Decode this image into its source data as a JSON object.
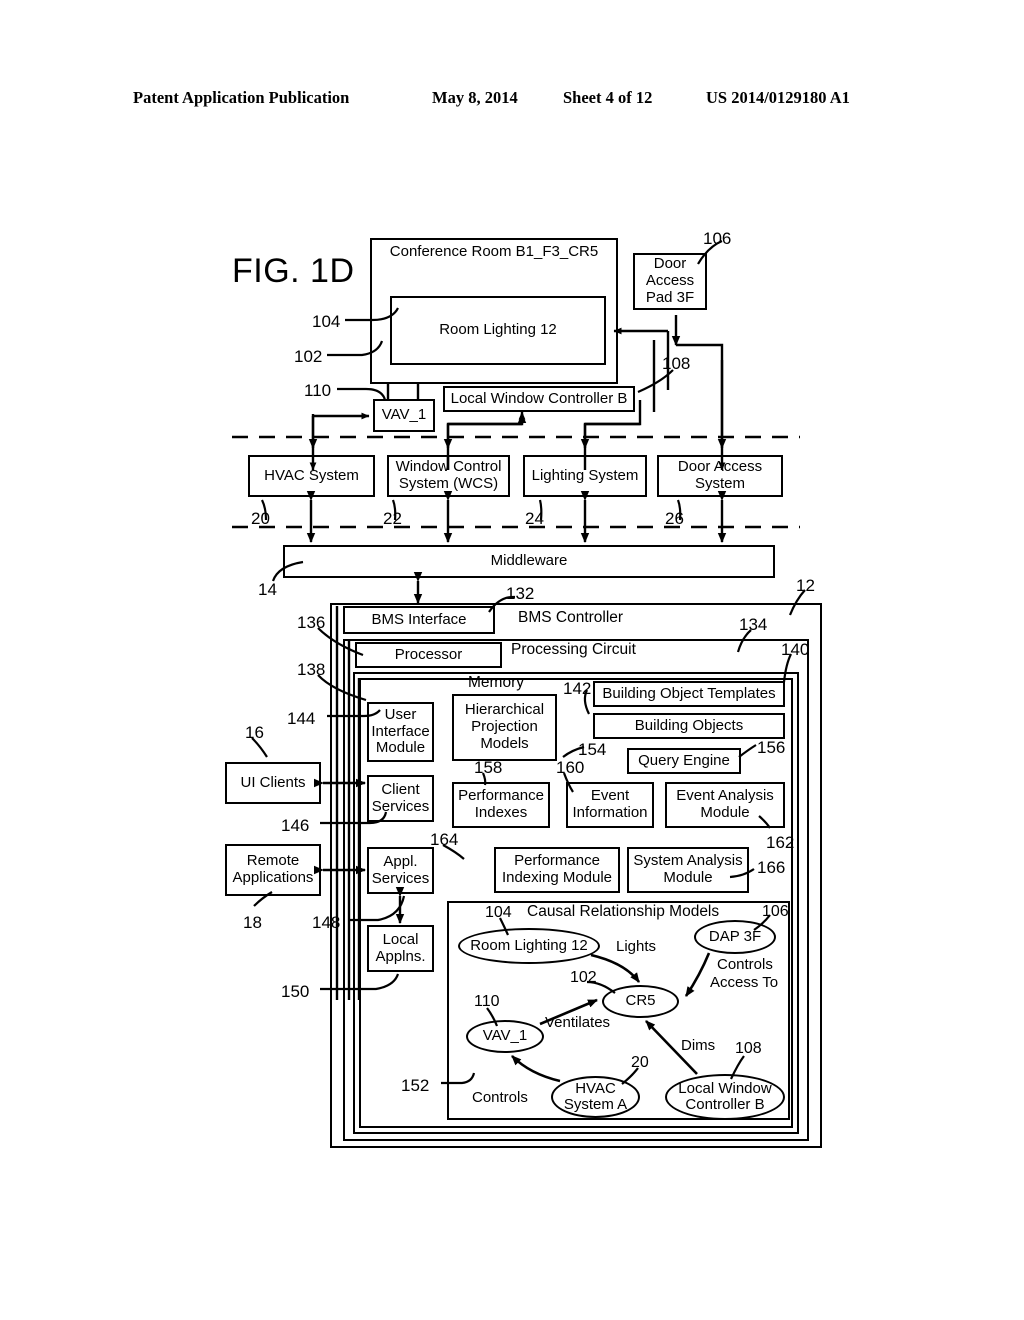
{
  "header": {
    "publication": "Patent Application Publication",
    "date": "May 8, 2014",
    "sheet": "Sheet 4 of 12",
    "patent_number": "US 2014/0129180 A1"
  },
  "figure": {
    "label": "FIG. 1D"
  },
  "top_section": {
    "conference_room": "Conference Room B1_F3_CR5",
    "room_lighting": "Room Lighting 12",
    "door_access_pad": "Door\nAccess\nPad 3F",
    "door_access_pad_lines": [
      "Door",
      "Access",
      "Pad 3F"
    ],
    "local_window_controller": "Local Window Controller B",
    "vav": "VAV_1",
    "refs": {
      "r102": "102",
      "r104": "104",
      "r106": "106",
      "r108": "108",
      "r110": "110"
    }
  },
  "systems_row": {
    "items": [
      {
        "label": "HVAC System",
        "ref": "20"
      },
      {
        "label": "Window Control\nSystem (WCS)",
        "ref": "22",
        "lines": [
          "Window Control",
          "System (WCS)"
        ]
      },
      {
        "label": "Lighting System",
        "ref": "24"
      },
      {
        "label": "Door Access\nSystem",
        "ref": "26",
        "lines": [
          "Door Access",
          "System"
        ]
      }
    ]
  },
  "middleware": {
    "label": "Middleware",
    "ref": "14"
  },
  "bms": {
    "controller_title": "BMS Controller",
    "controller_ref": "12",
    "interface_label": "BMS Interface",
    "interface_ref": "132",
    "processing_circuit_title": "Processing Circuit",
    "processing_circuit_ref": "134",
    "processor_label": "Processor",
    "processor_ref": "136",
    "memory_title": "Memory",
    "memory_ref": "138",
    "memory_outer_ref": "140"
  },
  "memory_modules": {
    "user_interface_module": {
      "label": "User\nInterface\nModule",
      "lines": [
        "User",
        "Interface",
        "Module"
      ],
      "ref": "144"
    },
    "client_services": {
      "label": "Client\nServices",
      "lines": [
        "Client",
        "Services"
      ],
      "ref": "146"
    },
    "appl_services": {
      "label": "Appl.\nServices",
      "lines": [
        "Appl.",
        "Services"
      ],
      "ref": "148"
    },
    "local_applns": {
      "label": "Local\nApplns.",
      "lines": [
        "Local",
        "Applns."
      ],
      "ref": "150"
    },
    "hierarchical_projection_models": {
      "label": "Hierarchical\nProjection\nModels",
      "lines": [
        "Hierarchical",
        "Projection",
        "Models"
      ],
      "ref": "154"
    },
    "building_object_templates": {
      "label": "Building Object Templates",
      "ref": "140"
    },
    "building_objects": {
      "label": "Building Objects",
      "ref": "142"
    },
    "query_engine": {
      "label": "Query Engine",
      "ref": "156"
    },
    "performance_indexes": {
      "label": "Performance\nIndexes",
      "lines": [
        "Performance",
        "Indexes"
      ],
      "ref": "158"
    },
    "event_information": {
      "label": "Event\nInformation",
      "lines": [
        "Event",
        "Information"
      ],
      "ref": "160"
    },
    "event_analysis_module": {
      "label": "Event Analysis\nModule",
      "lines": [
        "Event Analysis",
        "Module"
      ],
      "ref": "162"
    },
    "performance_indexing_module": {
      "label": "Performance\nIndexing Module",
      "lines": [
        "Performance",
        "Indexing Module"
      ],
      "ref": "164"
    },
    "system_analysis_module": {
      "label": "System Analysis\nModule",
      "lines": [
        "System Analysis",
        "Module"
      ],
      "ref": "166"
    }
  },
  "external_clients": {
    "ui_clients": {
      "label": "UI Clients",
      "ref": "16"
    },
    "remote_applications": {
      "label": "Remote\nApplications",
      "lines": [
        "Remote",
        "Applications"
      ],
      "ref": "18"
    }
  },
  "causal_models": {
    "title": "Causal Relationship Models",
    "ref": "152",
    "nodes": [
      {
        "id": "room_lighting",
        "label": "Room Lighting 12",
        "ref": "104"
      },
      {
        "id": "dap",
        "label": "DAP 3F",
        "ref": "106"
      },
      {
        "id": "cr5",
        "label": "CR5",
        "ref": "102"
      },
      {
        "id": "vav",
        "label": "VAV_1",
        "ref": "110"
      },
      {
        "id": "hvac",
        "label": "HVAC\nSystem A",
        "lines": [
          "HVAC",
          "System A"
        ],
        "ref": "20"
      },
      {
        "id": "lwc",
        "label": "Local Window\nController B",
        "lines": [
          "Local Window",
          "Controller B"
        ],
        "ref": "108"
      }
    ],
    "edges": [
      {
        "from": "room_lighting",
        "to": "cr5",
        "label": "Lights"
      },
      {
        "from": "dap",
        "to": "cr5",
        "label": "Controls\nAccess To",
        "lines": [
          "Controls",
          "Access To"
        ]
      },
      {
        "from": "vav",
        "to": "cr5",
        "label": "Ventilates"
      },
      {
        "from": "lwc",
        "to": "cr5",
        "label": "Dims"
      },
      {
        "from": "hvac",
        "to": "vav",
        "label": "Controls"
      }
    ]
  }
}
